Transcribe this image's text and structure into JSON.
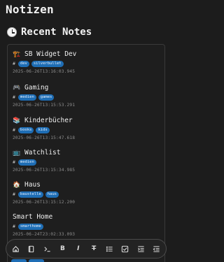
{
  "page": {
    "title": "Notizen"
  },
  "section": {
    "heading": "Recent Notes",
    "icon": "clock-icon"
  },
  "notes": [
    {
      "emoji": "🏗️",
      "title": "SB Widget Dev",
      "tags": [
        "dev",
        "silverbullet"
      ],
      "date": "2025-06-26T13:16:03.945"
    },
    {
      "emoji": "🎮",
      "title": "Gaming",
      "tags": [
        "medien",
        "games"
      ],
      "date": "2025-06-26T13:15:53.291"
    },
    {
      "emoji": "📚",
      "title": "Kinderbücher",
      "tags": [
        "books",
        "kids"
      ],
      "date": "2025-06-26T13:15:47.618"
    },
    {
      "emoji": "📺",
      "title": "Watchlist",
      "tags": [
        "medien"
      ],
      "date": "2025-06-26T13:15:34.985"
    },
    {
      "emoji": "🏠",
      "title": "Haus",
      "tags": [
        "baustelle",
        "haus"
      ],
      "date": "2025-06-26T13:15:12.200"
    },
    {
      "emoji": "",
      "title": "Smart Home",
      "tags": [
        "smarthome"
      ],
      "date": "2025-06-24T23:02:33.093"
    }
  ],
  "toolbar": {
    "bold_label": "B",
    "italic_label": "I",
    "strike_label": "T",
    "items": [
      "home-icon",
      "book-icon",
      "terminal-icon",
      "bold-icon",
      "italic-icon",
      "strikethrough-icon",
      "list-icon",
      "checkbox-icon",
      "indent-icon",
      "outdent-icon"
    ]
  },
  "colors": {
    "background": "#1c1c1c",
    "tag": "#1e6db4",
    "date": "#8d8d8d"
  }
}
